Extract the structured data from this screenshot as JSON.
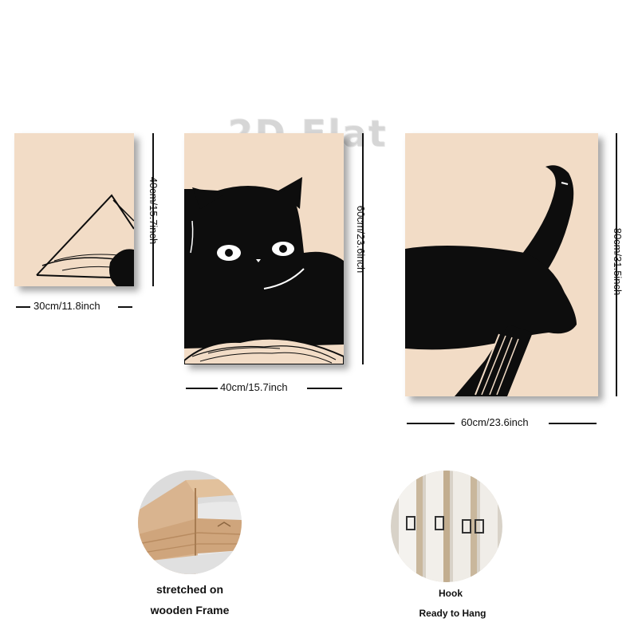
{
  "watermark": "2D Flat",
  "panels": [
    {
      "id": "small",
      "width_label": "30cm/11.8inch",
      "height_label": "40cm/15.7inch"
    },
    {
      "id": "medium",
      "width_label": "40cm/15.7inch",
      "height_label": "60cm/23.6inch"
    },
    {
      "id": "large",
      "width_label": "60cm/23.6inch",
      "height_label": "80cm/31.5inch"
    }
  ],
  "details": [
    {
      "id": "frame",
      "caption_line1": "stretched on",
      "caption_line2": "wooden Frame"
    },
    {
      "id": "hook",
      "caption_line1": "Hook",
      "caption_line2": "Ready to Hang"
    }
  ],
  "colors": {
    "canvas_bg": "#f2dcc6",
    "ink": "#0d0d0d",
    "wood": "#d9b48f"
  }
}
